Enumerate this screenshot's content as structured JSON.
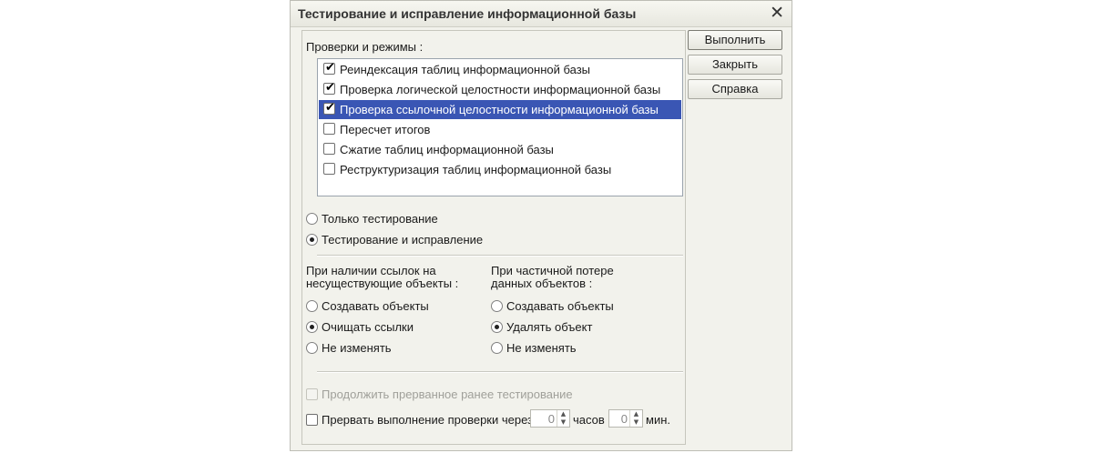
{
  "window": {
    "title": "Тестирование и исправление информационной базы",
    "close_symbol": "✕"
  },
  "checks": {
    "header": "Проверки и режимы :",
    "items": [
      {
        "label": "Реиндексация таблиц информационной базы",
        "checked": true
      },
      {
        "label": "Проверка логической целостности информационной базы",
        "checked": true
      },
      {
        "label": "Проверка ссылочной целостности информационной базы",
        "checked": true,
        "selected": true
      },
      {
        "label": "Пересчет итогов",
        "checked": false
      },
      {
        "label": "Сжатие таблиц информационной базы",
        "checked": false
      },
      {
        "label": "Реструктуризация таблиц информационной базы",
        "checked": false
      }
    ]
  },
  "mode": {
    "options": [
      {
        "label": "Только тестирование",
        "selected": false
      },
      {
        "label": "Тестирование и исправление",
        "selected": true
      }
    ]
  },
  "refs_missing": {
    "header_line1": "При наличии ссылок на",
    "header_line2": "несуществующие объекты :",
    "options": [
      {
        "label": "Создавать объекты",
        "selected": false
      },
      {
        "label": "Очищать ссылки",
        "selected": true
      },
      {
        "label": "Не изменять",
        "selected": false
      }
    ]
  },
  "partial_loss": {
    "header_line1": "При частичной потере",
    "header_line2": "данных объектов :",
    "options": [
      {
        "label": "Создавать объекты",
        "selected": false
      },
      {
        "label": "Удалять объект",
        "selected": true
      },
      {
        "label": "Не изменять",
        "selected": false
      }
    ]
  },
  "continue_interrupted": {
    "label": "Продолжить прерванное ранее тестирование",
    "checked": false,
    "disabled": true
  },
  "interrupt": {
    "label": "Прервать выполнение проверки через",
    "checked": false,
    "hours_value": "0",
    "hours_unit": "часов",
    "minutes_value": "0",
    "minutes_unit": "мин."
  },
  "buttons": {
    "run": "Выполнить",
    "close": "Закрыть",
    "help": "Справка"
  },
  "glyphs": {
    "check": "✔",
    "spin_up": "▲",
    "spin_down": "▼"
  }
}
